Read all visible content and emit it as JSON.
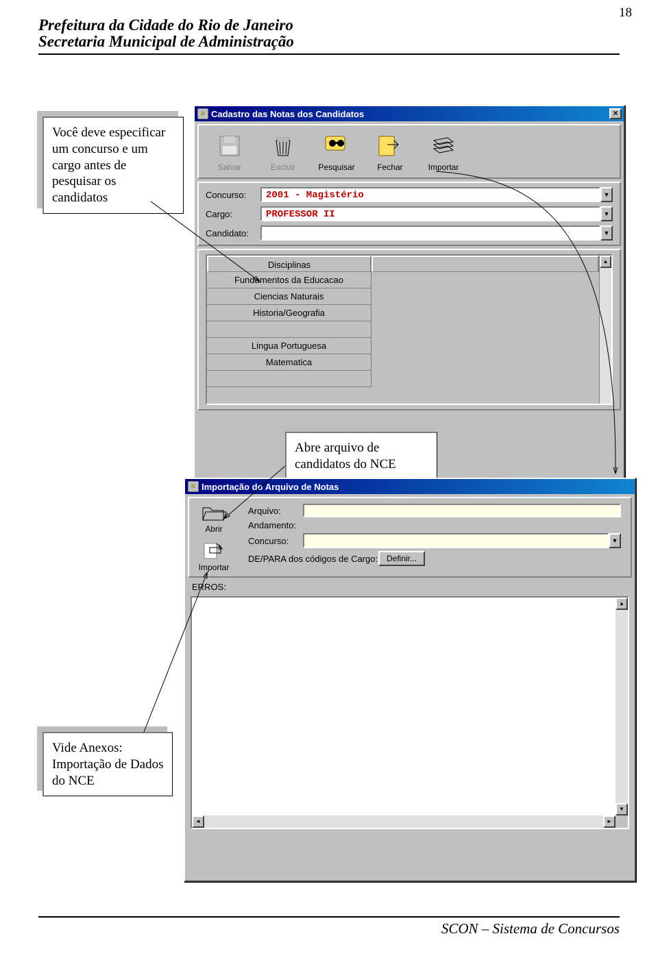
{
  "page_number": "18",
  "header": {
    "line1": "Prefeitura da Cidade do Rio de Janeiro",
    "line2": "Secretaria Municipal de Administração"
  },
  "callouts": {
    "c1": "Você deve especificar um  concurso e um cargo antes de pesquisar os candidatos",
    "c2": "Abre arquivo de candidatos do NCE",
    "c3": "Vide Anexos: Importação de Dados do NCE"
  },
  "window1": {
    "title": "Cadastro das Notas dos Candidatos",
    "toolbar": {
      "salvar": "Salvar",
      "excluir": "Excluir",
      "pesquisar": "Pesquisar",
      "fechar": "Fechar",
      "importar": "Importar"
    },
    "labels": {
      "concurso": "Concurso:",
      "cargo": "Cargo:",
      "candidato": "Candidato:"
    },
    "values": {
      "concurso": "2001 - Magistério",
      "cargo": "PROFESSOR II",
      "candidato": ""
    },
    "grid_header": "Disciplinas",
    "disciplinas": [
      "Fundamentos da Educacao",
      "Ciencias Naturais",
      "Historia/Geografia",
      "",
      "Lingua Portuguesa",
      "Matematica",
      ""
    ]
  },
  "window2": {
    "title": "Importação do Arquivo de Notas",
    "btn_abrir": "Abrir",
    "btn_importar": "Importar",
    "labels": {
      "arquivo": "Arquivo:",
      "andamento": "Andamento:",
      "concurso": "Concurso:",
      "depara": "DE/PARA dos códigos de Cargo:",
      "erros": "ERROS:"
    },
    "definir": "Definir..."
  },
  "footer": "SCON – Sistema de Concursos"
}
